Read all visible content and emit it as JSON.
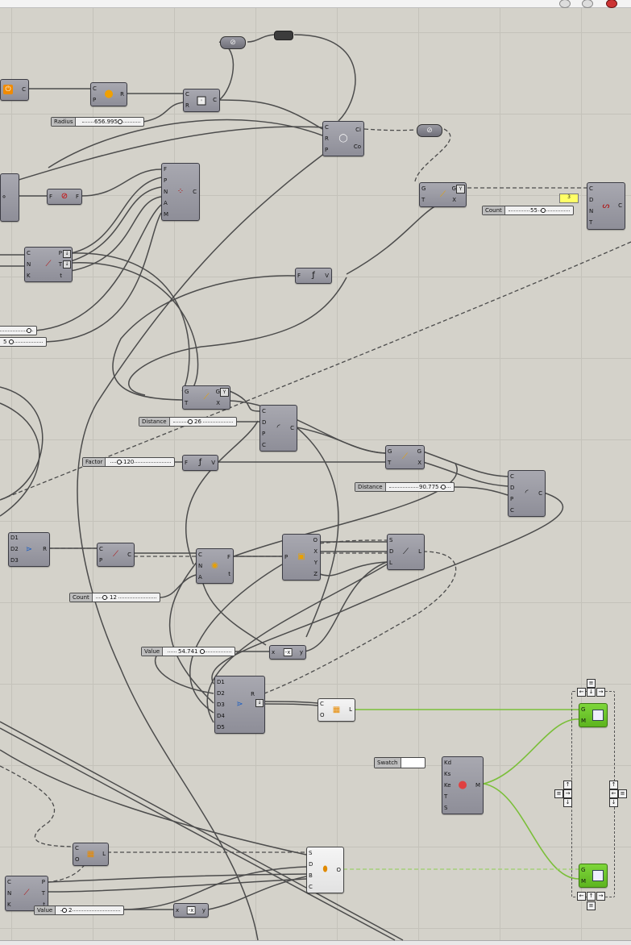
{
  "sliders": {
    "radius": {
      "label": "Radius",
      "value": "656.995"
    },
    "count_top": {
      "label": "Count",
      "value": "55"
    },
    "left_five": {
      "label": "",
      "value": "5"
    },
    "distance_a": {
      "label": "Distance",
      "value": "26"
    },
    "factor": {
      "label": "Factor",
      "value": "120"
    },
    "distance_b": {
      "label": "Distance",
      "value": "90.775"
    },
    "count_mid": {
      "label": "Count",
      "value": "12"
    },
    "value_mid": {
      "label": "Value",
      "value": "54.741"
    },
    "value_bottom": {
      "label": "Value",
      "value": "2"
    }
  },
  "panel": {
    "value": "3"
  },
  "swatch": {
    "label": "Swatch",
    "color": "#ffffff"
  },
  "colors": {
    "wire": "#4c4c4c",
    "preview_wire": "#7bbf3a",
    "component": "#9a9aa2",
    "canvas": "#d4d2ca"
  },
  "components": {
    "curve_param": {
      "inputs": [],
      "outputs": [
        "C"
      ],
      "icon": "power-icon"
    },
    "blob": {
      "inputs": [
        "C",
        "P"
      ],
      "outputs": [
        "R"
      ],
      "icon": "blob-icon"
    },
    "circle_box": {
      "inputs": [
        "C",
        "R"
      ],
      "outputs": [
        "C"
      ],
      "icon": "circle-point-icon"
    },
    "circle_cnr": {
      "inputs": [
        "C",
        "R",
        "P"
      ],
      "outputs": [
        "Ci",
        "Co"
      ],
      "icon": "circle-cnr-icon"
    },
    "graph_mapper_top": {
      "inputs": [
        "G",
        "T"
      ],
      "outputs": [
        "G",
        "X"
      ],
      "icon": "graph-icon"
    },
    "divide_curve": {
      "inputs": [
        "C",
        "D",
        "N",
        "T"
      ],
      "outputs": [
        "C"
      ],
      "icon": "divide-icon"
    },
    "flip": {
      "inputs": [
        "F"
      ],
      "outputs": [
        "F"
      ],
      "icon": "flip-icon"
    },
    "pop_geo": {
      "inputs": [
        "F",
        "P",
        "N",
        "A",
        "M"
      ],
      "outputs": [
        "C"
      ],
      "icon": "points-icon"
    },
    "curve_cnk": {
      "inputs": [
        "C",
        "N",
        "K"
      ],
      "outputs": [
        "P",
        "T",
        "t"
      ],
      "icon": "curve-icon"
    },
    "expr_f_top": {
      "inputs": [
        "F"
      ],
      "outputs": [
        "V"
      ],
      "icon": "expression-icon"
    },
    "graph_mapper_mid": {
      "inputs": [
        "G",
        "T"
      ],
      "outputs": [
        "G",
        "X"
      ],
      "icon": "graph-icon"
    },
    "arc_cdpc_a": {
      "inputs": [
        "C",
        "D",
        "P",
        "C"
      ],
      "outputs": [
        "C"
      ],
      "icon": "arc-icon"
    },
    "expr_f_mid": {
      "inputs": [
        "F"
      ],
      "outputs": [
        "V"
      ],
      "icon": "expression-icon"
    },
    "graph_mapper_right": {
      "inputs": [
        "G",
        "T"
      ],
      "outputs": [
        "G",
        "X"
      ],
      "icon": "graph-icon"
    },
    "arc_cdpc_b": {
      "inputs": [
        "C",
        "D",
        "P",
        "C"
      ],
      "outputs": [
        "C"
      ],
      "icon": "arc-icon"
    },
    "merge_d123": {
      "inputs": [
        "D1",
        "D2",
        "D3"
      ],
      "outputs": [
        "R"
      ],
      "icon": "merge-icon"
    },
    "curve_cp": {
      "inputs": [
        "C",
        "P"
      ],
      "outputs": [
        "C"
      ],
      "icon": "curve-icon"
    },
    "evaluate_cna": {
      "inputs": [
        "C",
        "N",
        "A"
      ],
      "outputs": [
        "F",
        "t"
      ],
      "icon": "evaluate-icon"
    },
    "deconstruct_p": {
      "inputs": [
        "P"
      ],
      "outputs": [
        "O",
        "X",
        "Y",
        "Z"
      ],
      "icon": "plane-icon"
    },
    "line_sdl": {
      "inputs": [
        "S",
        "D",
        "L"
      ],
      "outputs": [
        "L"
      ],
      "icon": "line-icon"
    },
    "negative_mid": {
      "inputs": [
        "x"
      ],
      "outputs": [
        "y"
      ],
      "icon": "negative-icon"
    },
    "merge_d12345": {
      "inputs": [
        "D1",
        "D2",
        "D3",
        "D4",
        "D5"
      ],
      "outputs": [
        "R"
      ],
      "icon": "merge-icon"
    },
    "mesh_co_top": {
      "inputs": [
        "C",
        "O"
      ],
      "outputs": [
        "L"
      ],
      "icon": "mesh-icon"
    },
    "material": {
      "inputs": [
        "Kd",
        "Ks",
        "Ke",
        "T",
        "S"
      ],
      "outputs": [
        "M"
      ],
      "icon": "material-icon"
    },
    "preview_top": {
      "inputs": [
        "G",
        "M"
      ],
      "outputs": [],
      "icon": "preview-icon"
    },
    "preview_bottom": {
      "inputs": [
        "G",
        "M"
      ],
      "outputs": [],
      "icon": "preview-icon"
    },
    "mesh_co_bottom": {
      "inputs": [
        "C",
        "O"
      ],
      "outputs": [
        "L"
      ],
      "icon": "mesh-icon"
    },
    "sweep": {
      "inputs": [
        "S",
        "D",
        "B",
        "C"
      ],
      "outputs": [
        "O"
      ],
      "icon": "sweep-icon"
    },
    "curve_cnk_bottom": {
      "inputs": [
        "C",
        "N",
        "K"
      ],
      "outputs": [
        "P",
        "T",
        "t"
      ],
      "icon": "curve-icon"
    },
    "negative_bottom": {
      "inputs": [
        "x"
      ],
      "outputs": [
        "y"
      ],
      "icon": "negative-icon"
    },
    "left_curve_out": {
      "inputs": [],
      "outputs": [
        "C"
      ],
      "icon": "param-icon"
    }
  }
}
